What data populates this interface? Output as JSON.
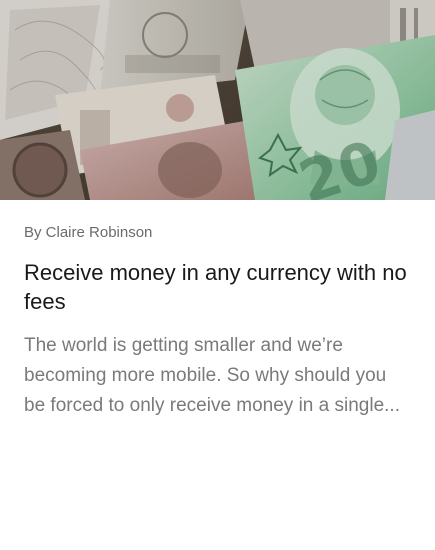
{
  "article": {
    "image_alt": "Assorted banknotes from several countries including a green Canadian twenty dollar bill",
    "author": "By Claire Robinson",
    "title": "Receive money in any currency with no fees",
    "excerpt": "The world is getting smaller and  we’re becoming more mobile. So why should you be forced to only receive money in a single..."
  }
}
